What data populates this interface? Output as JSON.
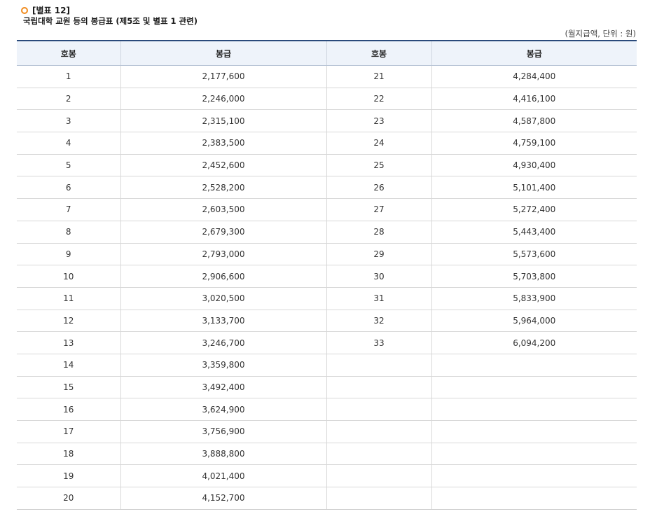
{
  "heading": {
    "label": "[별표 12]",
    "subtitle": "국립대학 교원 등의 봉급표 (제5조 및 별표 1 관련)",
    "unit": "(월지급액, 단위 : 원)"
  },
  "table": {
    "headers": [
      "호봉",
      "봉급",
      "호봉",
      "봉급"
    ],
    "rows": [
      [
        "1",
        "2,177,600",
        "21",
        "4,284,400"
      ],
      [
        "2",
        "2,246,000",
        "22",
        "4,416,100"
      ],
      [
        "3",
        "2,315,100",
        "23",
        "4,587,800"
      ],
      [
        "4",
        "2,383,500",
        "24",
        "4,759,100"
      ],
      [
        "5",
        "2,452,600",
        "25",
        "4,930,400"
      ],
      [
        "6",
        "2,528,200",
        "26",
        "5,101,400"
      ],
      [
        "7",
        "2,603,500",
        "27",
        "5,272,400"
      ],
      [
        "8",
        "2,679,300",
        "28",
        "5,443,400"
      ],
      [
        "9",
        "2,793,000",
        "29",
        "5,573,600"
      ],
      [
        "10",
        "2,906,600",
        "30",
        "5,703,800"
      ],
      [
        "11",
        "3,020,500",
        "31",
        "5,833,900"
      ],
      [
        "12",
        "3,133,700",
        "32",
        "5,964,000"
      ],
      [
        "13",
        "3,246,700",
        "33",
        "6,094,200"
      ],
      [
        "14",
        "3,359,800",
        "",
        ""
      ],
      [
        "15",
        "3,492,400",
        "",
        ""
      ],
      [
        "16",
        "3,624,900",
        "",
        ""
      ],
      [
        "17",
        "3,756,900",
        "",
        ""
      ],
      [
        "18",
        "3,888,800",
        "",
        ""
      ],
      [
        "19",
        "4,021,400",
        "",
        ""
      ],
      [
        "20",
        "4,152,700",
        "",
        ""
      ]
    ]
  },
  "colors": {
    "bullet": "#f18b1d",
    "header_bg": "#eef3fa",
    "header_rule": "#2a4a7b"
  }
}
